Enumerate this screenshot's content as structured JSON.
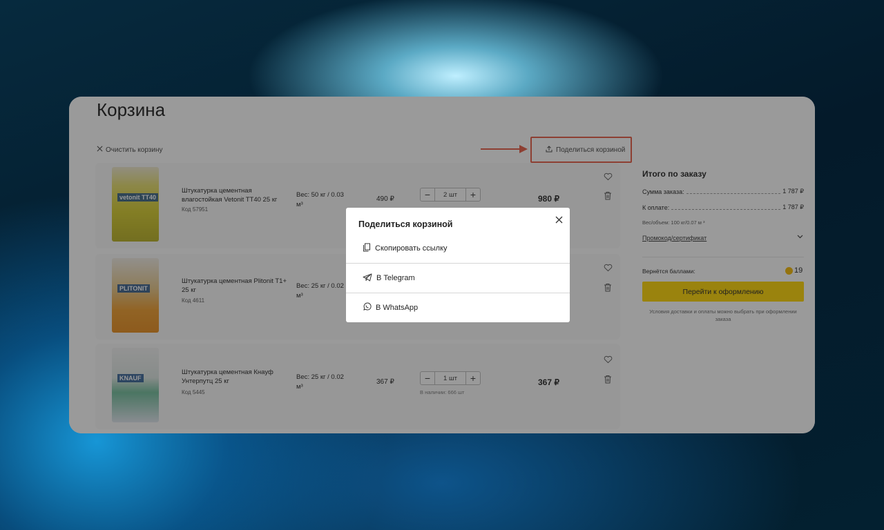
{
  "page": {
    "title": "Корзина",
    "clear_cart": "Очистить корзину",
    "share_cart": "Поделиться корзиной"
  },
  "items": [
    {
      "name": "Штукатурка цементная влагостойкая Vetonit TT40 25 кг",
      "code": "Код 57951",
      "weight": "Вес: 50 кг / 0.03 м³",
      "unit_price": "490 ₽",
      "qty": "2 шт",
      "total": "980 ₽",
      "image_label": "vetonit TT40"
    },
    {
      "name": "Штукатурка цементная Plitonit T1+ 25 кг",
      "code": "Код 4611",
      "weight": "Вес: 25 кг / 0.02 м³",
      "image_label": "PLITONIT"
    },
    {
      "name": "Штукатурка цементная Кнауф Унтерпутц 25 кг",
      "code": "Код 5445",
      "weight": "Вес: 25 кг / 0.02 м³",
      "unit_price": "367 ₽",
      "qty": "1 шт",
      "stock": "В наличии: 666 шт",
      "total": "367 ₽",
      "image_label": "KNAUF"
    }
  ],
  "summary": {
    "title": "Итого по заказу",
    "order_sum_label": "Сумма заказа:",
    "order_sum_value": "1 787 ₽",
    "to_pay_label": "К оплате:",
    "to_pay_value": "1 787 ₽",
    "weight_volume": "Вес/объем: 100 кг/0.07 м ³",
    "promo": "Промокод/сертификат",
    "bonus_label": "Вернётся баллами:",
    "bonus_value": "19",
    "checkout": "Перейти к оформлению",
    "terms": "Условия доставки и оплаты можно выбрать при оформлении заказа"
  },
  "modal": {
    "title": "Поделиться корзиной",
    "options": [
      {
        "label": "Скопировать ссылку",
        "icon": "copy-icon"
      },
      {
        "label": "В Telegram",
        "icon": "telegram-icon"
      },
      {
        "label": "В WhatsApp",
        "icon": "whatsapp-icon"
      }
    ]
  },
  "colors": {
    "accent": "#ffd600",
    "highlight": "#e85a42"
  }
}
